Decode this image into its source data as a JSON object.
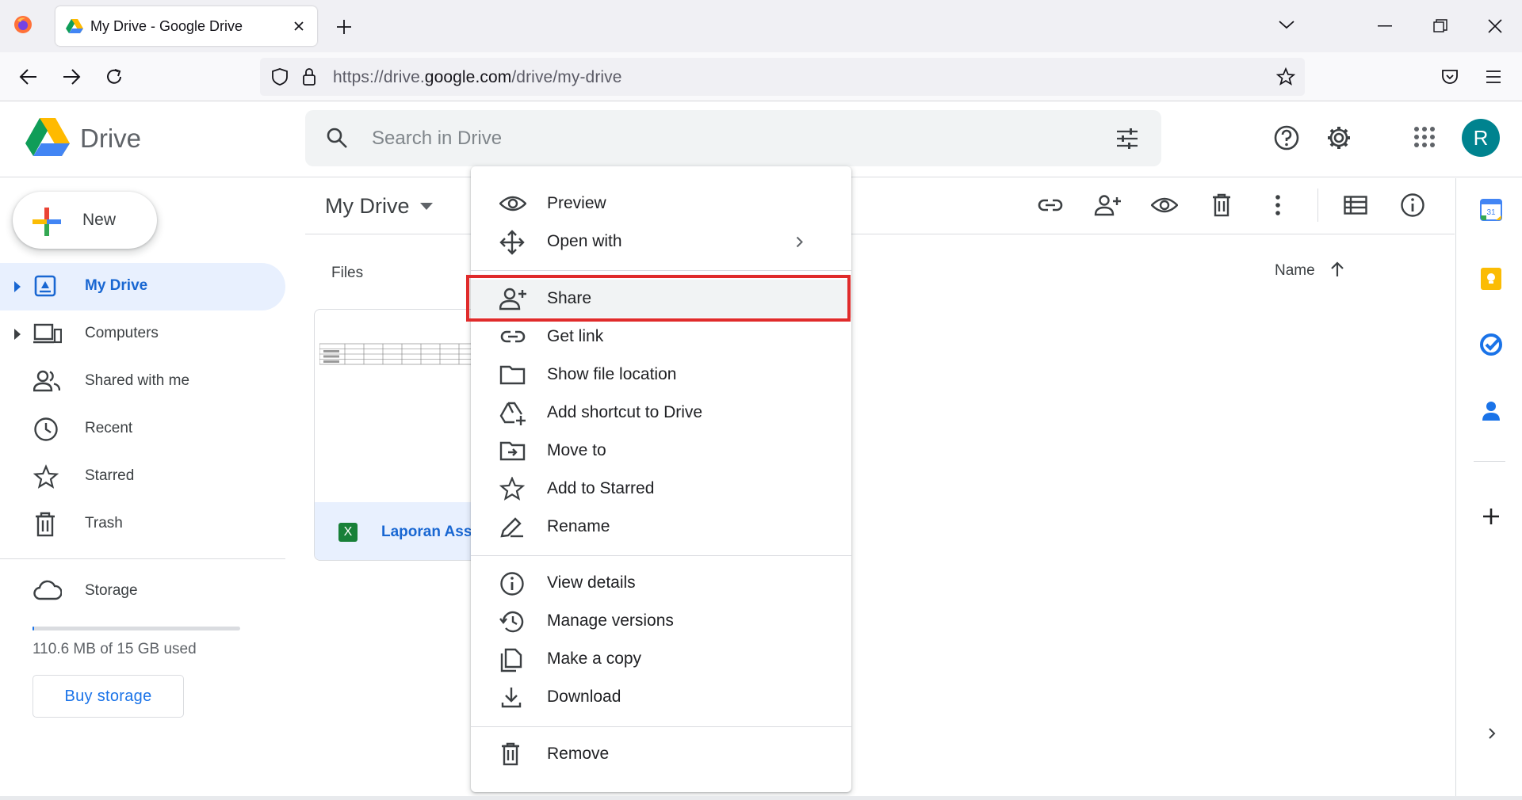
{
  "browser": {
    "tab_title": "My Drive - Google Drive",
    "url_prefix": "https://drive.",
    "url_domain": "google.com",
    "url_path": "/drive/my-drive"
  },
  "header": {
    "product_name": "Drive",
    "search_placeholder": "Search in Drive",
    "avatar_initial": "R"
  },
  "sidebar": {
    "new_label": "New",
    "items": [
      {
        "label": "My Drive"
      },
      {
        "label": "Computers"
      },
      {
        "label": "Shared with me"
      },
      {
        "label": "Recent"
      },
      {
        "label": "Starred"
      },
      {
        "label": "Trash"
      }
    ],
    "storage_label": "Storage",
    "storage_text": "110.6 MB of 15 GB used",
    "storage_fraction": 0.007,
    "buy_storage_label": "Buy storage"
  },
  "main": {
    "title": "My Drive",
    "files_label": "Files",
    "sort_label": "Name",
    "file": {
      "name": "Laporan Asse",
      "type_badge": "X"
    }
  },
  "context_menu": {
    "items": [
      {
        "label": "Preview"
      },
      {
        "label": "Open with"
      },
      {
        "label": "Share"
      },
      {
        "label": "Get link"
      },
      {
        "label": "Show file location"
      },
      {
        "label": "Add shortcut to Drive"
      },
      {
        "label": "Move to"
      },
      {
        "label": "Add to Starred"
      },
      {
        "label": "Rename"
      },
      {
        "label": "View details"
      },
      {
        "label": "Manage versions"
      },
      {
        "label": "Make a copy"
      },
      {
        "label": "Download"
      },
      {
        "label": "Remove"
      }
    ]
  },
  "right_panel": {
    "calendar_day": "31"
  },
  "colors": {
    "accent_blue": "#1a73e8",
    "active_bg": "#e8f0fe",
    "highlight_red": "#e02b2b",
    "avatar_bg": "#00838f"
  }
}
